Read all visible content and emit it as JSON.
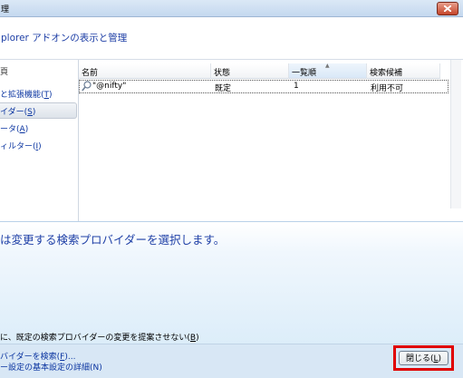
{
  "window": {
    "title": "理",
    "accent_close": "#c5442a"
  },
  "header": {
    "title": "plorer アドオンの表示と管理"
  },
  "sidebar": {
    "heading": "頁",
    "items": [
      {
        "text": "と拡張機能(",
        "key": "T",
        "tail": ")"
      },
      {
        "text": "イダー(",
        "key": "S",
        "tail": ")",
        "selected": true
      },
      {
        "text": "ータ(",
        "key": "A",
        "tail": ")"
      },
      {
        "text": "ィルター(",
        "key": "I",
        "tail": ")"
      }
    ]
  },
  "list": {
    "columns": [
      "名前",
      "状態",
      "一覧順",
      "検索候補"
    ],
    "sorted_column": "一覧順",
    "rows": [
      {
        "name": "\"@nifty\"",
        "status": "既定",
        "order": "1",
        "suggestions": "利用不可",
        "icon": "search-icon"
      }
    ]
  },
  "details": {
    "message": "は変更する検索プロバイダーを選択します。",
    "checkbox_text": "に、既定の検索プロバイダーの変更を提案させない(",
    "checkbox_key": "B",
    "checkbox_tail": ")"
  },
  "footer": {
    "link1_text": "バイダーを検索(",
    "link1_key": "F",
    "link1_tail": ")...",
    "link2_text": "ー設定の基本設定の詳細(N)",
    "close_button_text": "閉じる(",
    "close_button_key": "L",
    "close_button_tail": ")",
    "highlight_color": "#e00000"
  }
}
